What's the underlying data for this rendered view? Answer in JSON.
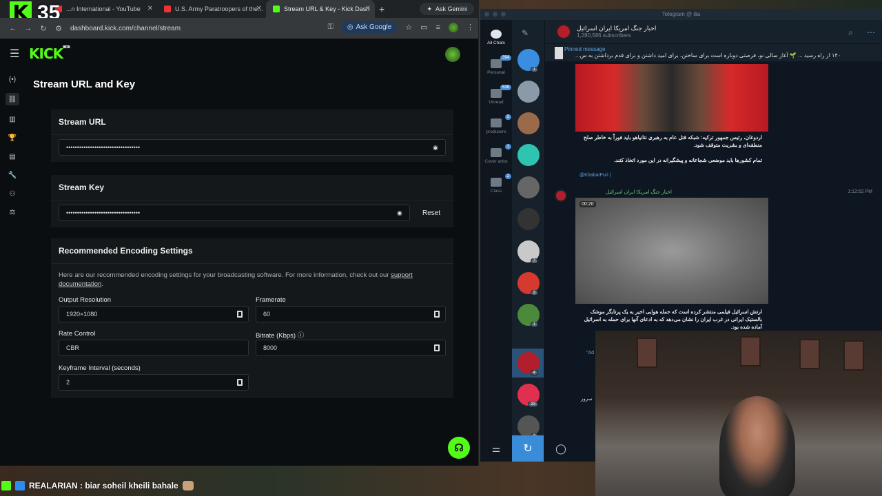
{
  "overlay": {
    "number": "35",
    "logo_letter": "K"
  },
  "browser": {
    "tabs": [
      {
        "label": "...n International - YouTube",
        "color": "#e33"
      },
      {
        "label": "U.S. Army Paratroopers of the...",
        "color": "#e33"
      },
      {
        "label": "Stream URL & Key - Kick Dash",
        "color": "#53fc18"
      }
    ],
    "ask_gemini": "Ask Gemini",
    "url": "dashboard.kick.com/channel/stream",
    "ask_google": "Ask Google"
  },
  "kick": {
    "logo": "KICK",
    "logo_sup": "BETA",
    "page_title": "Stream URL and Key",
    "stream_url": {
      "title": "Stream URL",
      "value": "••••••••••••••••••••••••••••••••••"
    },
    "stream_key": {
      "title": "Stream Key",
      "value": "••••••••••••••••••••••••••••••••••",
      "reset": "Reset"
    },
    "encoding": {
      "title": "Recommended Encoding Settings",
      "desc": "Here are our recommended encoding settings for your broadcasting software. For more information, check out our",
      "link": "support documentation",
      "output_resolution": {
        "label": "Output Resolution",
        "value": "1920×1080"
      },
      "framerate": {
        "label": "Framerate",
        "value": "60"
      },
      "rate_control": {
        "label": "Rate Control",
        "value": "CBR"
      },
      "bitrate": {
        "label": "Bitrate (Kbps)",
        "value": "8000"
      },
      "keyframe": {
        "label": "Keyframe Interval (seconds)",
        "value": "2"
      }
    }
  },
  "telegram": {
    "window_title": "Telegram @ ilia",
    "folders": [
      {
        "label": "All Chats",
        "badge": ""
      },
      {
        "label": "Personal",
        "badge": "394"
      },
      {
        "label": "Unread",
        "badge": "538"
      },
      {
        "label": "producers",
        "badge": "3"
      },
      {
        "label": "Cover artist",
        "badge": "1"
      },
      {
        "label": "Class",
        "badge": "2"
      }
    ],
    "channel_title": "اخبار جنگ امریکا ایران اسرائیل",
    "subscribers": "1,280,586 subscribers",
    "pinned_label": "Pinned message",
    "pinned_text": "۱۴۰ از راه رسید ... 🌱 آغاز سالی نو، فرصتی دوباره است برای ساختن، برای امید داشتن و برای قدم برداشتن به س...",
    "msg1": "اردوغان، رئیس جمهور ترکیه: شبکه قتل عام به رهبری نتانیاهو باید فوراً به خاطر صلح منطقه‌ای و بشریت متوقف شود.",
    "msg1b": "تمام کشورها باید موضعی شجاعانه و پیشگیرانه در این مورد اتخاذ کنند.",
    "msg1_link": "@KhabarFuri |",
    "msg2_sender": "اخبار جنگ امریکا ایران اسرائیل",
    "msg2_time": "1:12:52 PM",
    "video_duration": "00:20",
    "msg2": "ارتش اسرائیل فیلمی منتشر کرده است که حمله هوایی اخیر به یک پرتابگر موشک بالستیک ایرانی در غرب ایران را نشان می‌دهد که به ادعای آنها برای حمله به اسرائیل آماده شده بود.",
    "partial_1": "\"Ad  w",
    "partial_2": "سرور"
  },
  "chat_message": "REALARIAN : biar soheil kheili bahale"
}
